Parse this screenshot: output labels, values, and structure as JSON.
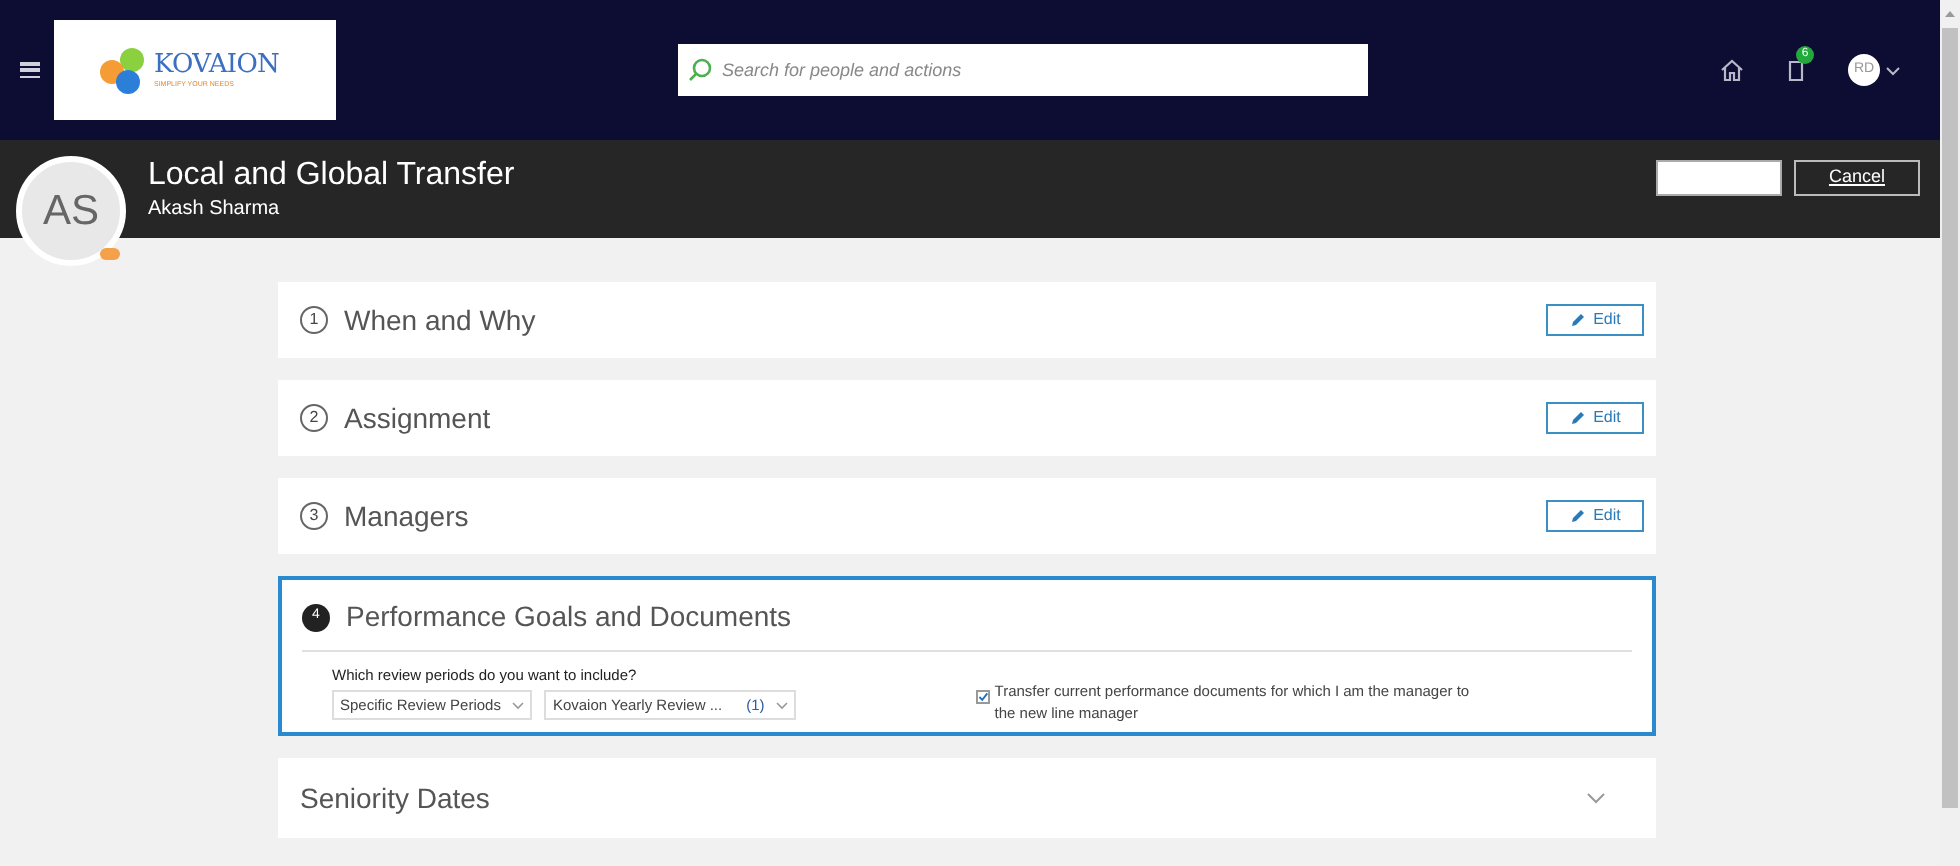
{
  "header": {
    "logo": {
      "name": "KOVAION",
      "tagline": "SIMPLIFY YOUR NEEDS"
    },
    "search": {
      "placeholder": "Search for people and actions"
    },
    "notifications": {
      "count": "6"
    },
    "user": {
      "initials": "RD"
    }
  },
  "title_bar": {
    "title": "Local and Global Transfer",
    "person": "Akash Sharma",
    "avatar": "AS",
    "actions": [
      {
        "kind": "blank"
      },
      {
        "kind": "cancel",
        "label": "Cancel"
      }
    ]
  },
  "steps": [
    {
      "number": "1",
      "title": "When and Why",
      "expanded": false,
      "action": "Edit"
    },
    {
      "number": "2",
      "title": "Assignment",
      "expanded": false,
      "action": "Edit"
    },
    {
      "number": "3",
      "title": "Managers",
      "expanded": false,
      "action": "Edit"
    },
    {
      "number": "4",
      "title": "Performance Goals and Documents",
      "expanded": true,
      "question": "Which review periods do you want to include?",
      "selects": [
        {
          "value": "Specific Review Periods"
        },
        {
          "value": "Kovaion Yearly Review ...",
          "count": "(1)"
        }
      ],
      "transfer": {
        "checked": true,
        "label": "Transfer current performance documents for which I am the manager to the new line manager"
      }
    }
  ],
  "collapsed_section": {
    "title": "Seniority Dates"
  }
}
